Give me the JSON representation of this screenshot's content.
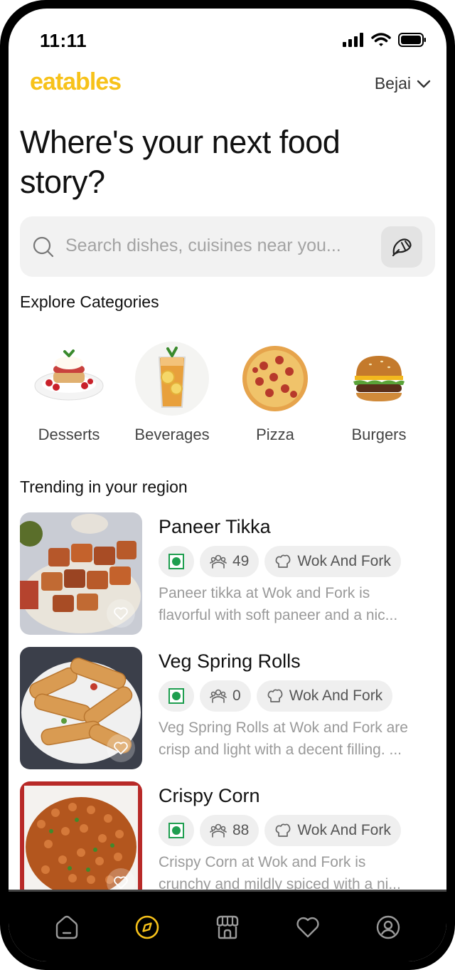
{
  "status_bar": {
    "time": "11:11"
  },
  "header": {
    "logo": "eatables",
    "location": "Bejai"
  },
  "headline": {
    "line1": "Where's your next food",
    "line2": "story?"
  },
  "search": {
    "placeholder": "Search dishes, cuisines near you..."
  },
  "categories": {
    "title": "Explore Categories",
    "items": [
      {
        "label": "Desserts"
      },
      {
        "label": "Beverages"
      },
      {
        "label": "Pizza"
      },
      {
        "label": "Burgers"
      }
    ]
  },
  "trending": {
    "title": "Trending in your region",
    "dishes": [
      {
        "name": "Paneer Tikka",
        "count": "49",
        "restaurant": "Wok And Fork",
        "desc1": "Paneer tikka at Wok and Fork is",
        "desc2": "flavorful with soft paneer and a nic..."
      },
      {
        "name": "Veg Spring Rolls",
        "count": "0",
        "restaurant": "Wok And Fork",
        "desc1": "Veg Spring Rolls at Wok and Fork are",
        "desc2": "crisp and light with a decent filling. ..."
      },
      {
        "name": "Crispy Corn",
        "count": "88",
        "restaurant": "Wok And Fork",
        "desc1": "Crispy Corn at Wok and Fork is",
        "desc2": "crunchy and mildly spiced with a ni..."
      }
    ]
  },
  "tab_bar": {
    "tabs": [
      {
        "icon": "home-icon"
      },
      {
        "icon": "explore-compass-icon",
        "active": true
      },
      {
        "icon": "store-icon"
      },
      {
        "icon": "heart-icon"
      },
      {
        "icon": "profile-icon"
      }
    ]
  },
  "colors": {
    "brand": "#f7c21a",
    "veg_green": "#1e9e4f"
  }
}
